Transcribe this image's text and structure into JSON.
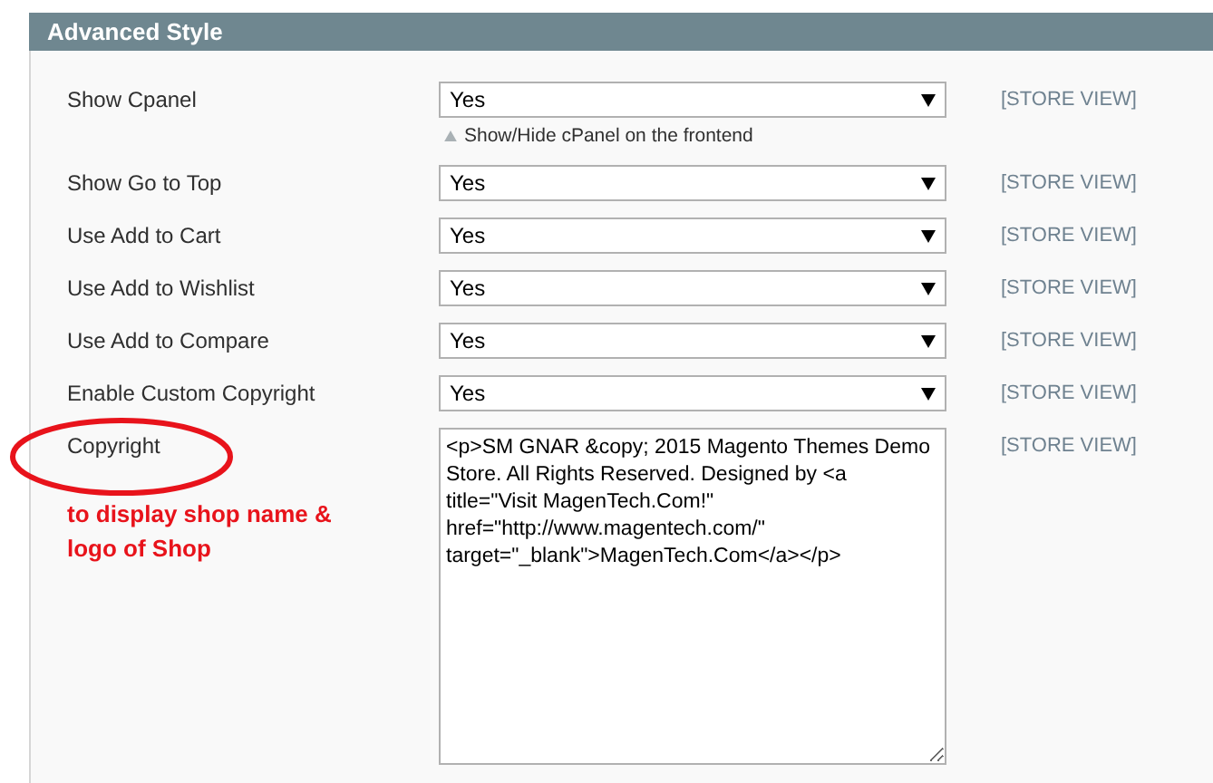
{
  "section": {
    "title": "Advanced Style"
  },
  "fields": [
    {
      "kind": "select",
      "label": "Show Cpanel",
      "value": "Yes",
      "hint": "Show/Hide cPanel on the frontend",
      "scope": "[STORE VIEW]"
    },
    {
      "kind": "select",
      "label": "Show Go to Top",
      "value": "Yes",
      "scope": "[STORE VIEW]"
    },
    {
      "kind": "select",
      "label": "Use Add to Cart",
      "value": "Yes",
      "scope": "[STORE VIEW]"
    },
    {
      "kind": "select",
      "label": "Use Add to Wishlist",
      "value": "Yes",
      "scope": "[STORE VIEW]"
    },
    {
      "kind": "select",
      "label": "Use Add to Compare",
      "value": "Yes",
      "scope": "[STORE VIEW]"
    },
    {
      "kind": "select",
      "label": "Enable Custom Copyright",
      "value": "Yes",
      "scope": "[STORE VIEW]"
    },
    {
      "kind": "textarea",
      "label": "Copyright",
      "value": "<p>SM GNAR &copy; 2015 Magento Themes Demo Store. All Rights Reserved. Designed by <a title=\"Visit MagenTech.Com!\" href=\"http://www.magentech.com/\" target=\"_blank\">MagenTech.Com</a></p>",
      "scope": "[STORE VIEW]"
    }
  ],
  "annotation": {
    "note": "to display shop name & logo of Shop"
  }
}
